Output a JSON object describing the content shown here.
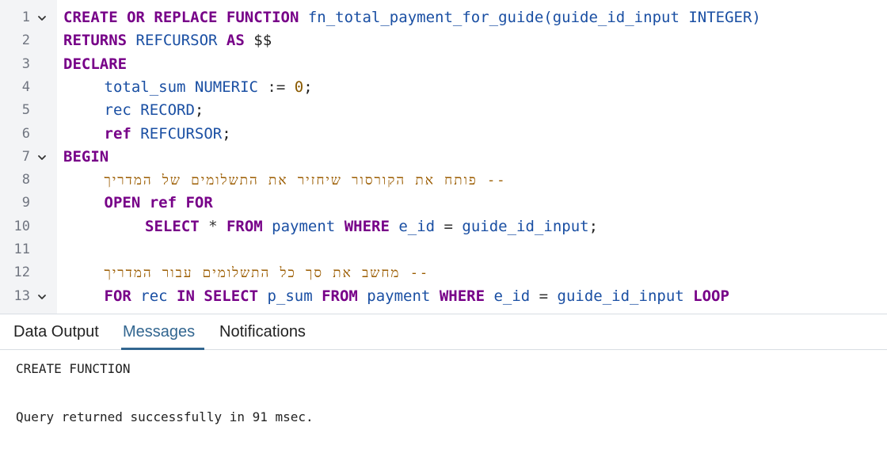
{
  "editor": {
    "lines": [
      {
        "n": "1",
        "fold": true,
        "indent": 0,
        "tokens": [
          {
            "t": "CREATE OR REPLACE FUNCTION",
            "c": "t-kw"
          },
          {
            "t": " fn_total_payment_for_guide",
            "c": "t-def"
          },
          {
            "t": "(",
            "c": "t-def"
          },
          {
            "t": "guide_id_input INTEGER",
            "c": "t-def"
          },
          {
            "t": ")",
            "c": "t-def"
          }
        ]
      },
      {
        "n": "2",
        "fold": false,
        "indent": 0,
        "tokens": [
          {
            "t": "RETURNS",
            "c": "t-kw"
          },
          {
            "t": " REFCURSOR ",
            "c": "t-var"
          },
          {
            "t": "AS",
            "c": "t-kw"
          },
          {
            "t": " $$",
            "c": "t-plain"
          }
        ]
      },
      {
        "n": "3",
        "fold": false,
        "indent": 0,
        "tokens": [
          {
            "t": "DECLARE",
            "c": "t-kw"
          }
        ]
      },
      {
        "n": "4",
        "fold": false,
        "indent": 1,
        "tokens": [
          {
            "t": "total_sum NUMERIC",
            "c": "t-var"
          },
          {
            "t": " := ",
            "c": "t-op"
          },
          {
            "t": "0",
            "c": "t-num"
          },
          {
            "t": ";",
            "c": "t-punc"
          }
        ]
      },
      {
        "n": "5",
        "fold": false,
        "indent": 1,
        "tokens": [
          {
            "t": "rec RECORD",
            "c": "t-var"
          },
          {
            "t": ";",
            "c": "t-punc"
          }
        ]
      },
      {
        "n": "6",
        "fold": false,
        "indent": 1,
        "tokens": [
          {
            "t": "ref",
            "c": "t-kw"
          },
          {
            "t": " REFCURSOR",
            "c": "t-var"
          },
          {
            "t": ";",
            "c": "t-punc"
          }
        ]
      },
      {
        "n": "7",
        "fold": true,
        "indent": 0,
        "tokens": [
          {
            "t": "BEGIN",
            "c": "t-kw"
          }
        ]
      },
      {
        "n": "8",
        "fold": false,
        "indent": 1,
        "tokens": [
          {
            "t": "-- פותח את הקורסור שיחזיר את התשלומים של המדריך",
            "c": "t-cmt",
            "rtl": true
          }
        ]
      },
      {
        "n": "9",
        "fold": false,
        "indent": 1,
        "tokens": [
          {
            "t": "OPEN",
            "c": "t-kw"
          },
          {
            "t": " ref ",
            "c": "t-kw"
          },
          {
            "t": "FOR",
            "c": "t-kw"
          }
        ]
      },
      {
        "n": "10",
        "fold": false,
        "indent": 2,
        "tokens": [
          {
            "t": "SELECT",
            "c": "t-kw"
          },
          {
            "t": " * ",
            "c": "t-op"
          },
          {
            "t": "FROM",
            "c": "t-kw"
          },
          {
            "t": " payment ",
            "c": "t-var"
          },
          {
            "t": "WHERE",
            "c": "t-kw"
          },
          {
            "t": " e_id ",
            "c": "t-var"
          },
          {
            "t": "=",
            "c": "t-op"
          },
          {
            "t": " guide_id_input",
            "c": "t-var"
          },
          {
            "t": ";",
            "c": "t-punc"
          }
        ]
      },
      {
        "n": "11",
        "fold": false,
        "indent": 0,
        "tokens": []
      },
      {
        "n": "12",
        "fold": false,
        "indent": 1,
        "tokens": [
          {
            "t": "-- מחשב את סך כל התשלומים עבור המדריך",
            "c": "t-cmt",
            "rtl": true
          }
        ]
      },
      {
        "n": "13",
        "fold": true,
        "indent": 1,
        "tokens": [
          {
            "t": "FOR",
            "c": "t-kw"
          },
          {
            "t": " rec ",
            "c": "t-var"
          },
          {
            "t": "IN",
            "c": "t-kw"
          },
          {
            "t": " ",
            "c": "t-plain"
          },
          {
            "t": "SELECT",
            "c": "t-kw"
          },
          {
            "t": " p_sum ",
            "c": "t-var"
          },
          {
            "t": "FROM",
            "c": "t-kw"
          },
          {
            "t": " payment ",
            "c": "t-var"
          },
          {
            "t": "WHERE",
            "c": "t-kw"
          },
          {
            "t": " e_id ",
            "c": "t-var"
          },
          {
            "t": "=",
            "c": "t-op"
          },
          {
            "t": " guide_id_input ",
            "c": "t-var"
          },
          {
            "t": "LOOP",
            "c": "t-kw"
          }
        ]
      }
    ]
  },
  "tabs": {
    "data_output": "Data Output",
    "messages": "Messages",
    "notifications": "Notifications",
    "active": "messages"
  },
  "messages": {
    "line1": "CREATE FUNCTION",
    "line2": "Query returned successfully in 91 msec."
  },
  "icons": {
    "fold": "chevron-down-icon"
  },
  "colors": {
    "keyword": "#770088",
    "identifier": "#1a4fa3",
    "number": "#8a5a00",
    "comment": "#9b5c00",
    "active_tab": "#326690",
    "gutter_bg": "#f3f4f6"
  }
}
